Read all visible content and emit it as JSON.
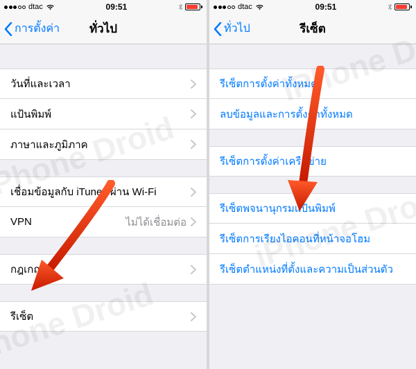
{
  "status": {
    "carrier": "dtac",
    "time": "09:51"
  },
  "left": {
    "back": "การตั้งค่า",
    "title": "ทั่วไป",
    "group1": [
      {
        "label": "วันที่และเวลา"
      },
      {
        "label": "แป้นพิมพ์"
      },
      {
        "label": "ภาษาและภูมิภาค"
      }
    ],
    "group2": [
      {
        "label": "เชื่อมข้อมูลกับ iTunes ผ่าน Wi-Fi"
      },
      {
        "label": "VPN",
        "value": "ไม่ได้เชื่อมต่อ"
      }
    ],
    "group3": [
      {
        "label": "กฎเกณฑ์"
      }
    ],
    "group4": [
      {
        "label": "รีเซ็ต"
      }
    ]
  },
  "right": {
    "back": "ทั่วไป",
    "title": "รีเซ็ต",
    "group1": [
      {
        "label": "รีเซ็ตการตั้งค่าทั้งหมด"
      },
      {
        "label": "ลบข้อมูลและการตั้งค่าทั้งหมด"
      }
    ],
    "group2": [
      {
        "label": "รีเซ็ตการตั้งค่าเครือข่าย"
      }
    ],
    "group3": [
      {
        "label": "รีเซ็ตพจนานุกรมแป้นพิมพ์"
      },
      {
        "label": "รีเซ็ตการเรียงไอคอนที่หน้าจอโฮม"
      },
      {
        "label": "รีเซ็ตตำแหน่งที่ตั้งและความเป็นส่วนตัว"
      }
    ]
  },
  "watermark": "iPhone Droid"
}
